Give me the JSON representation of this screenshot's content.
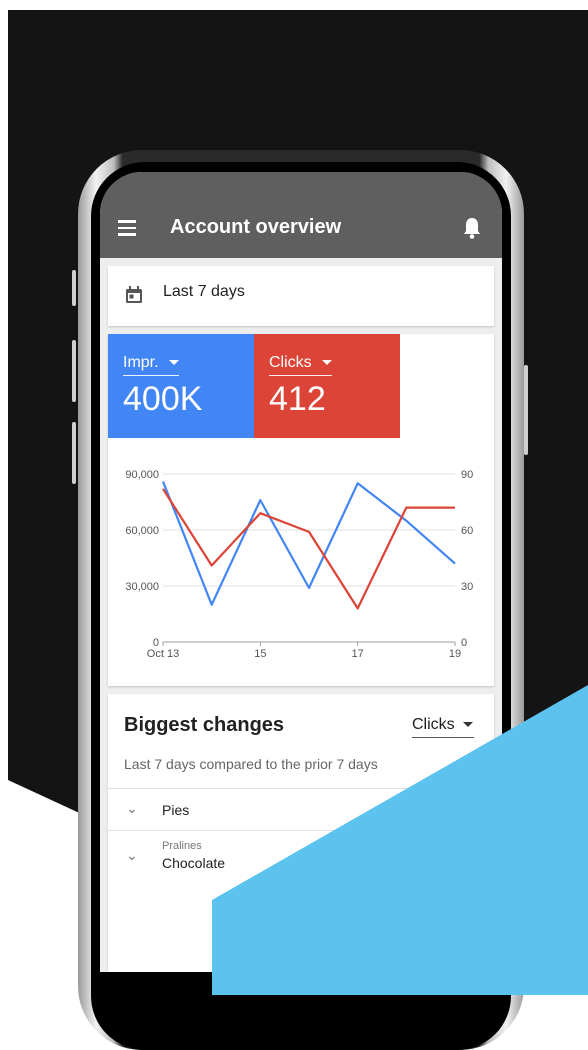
{
  "app": {
    "title": "Account overview"
  },
  "date_range": {
    "label": "Last 7 days"
  },
  "metrics": [
    {
      "label": "Impr.",
      "value": "400K",
      "color": "#4285f4"
    },
    {
      "label": "Clicks",
      "value": "412",
      "color": "#db4437"
    }
  ],
  "colors": {
    "appbar": "#5f5f5f",
    "background_dark": "#141414",
    "accent_shape": "#5bc3ee"
  },
  "chart_data": {
    "type": "line",
    "x_tick_labels": [
      "Oct 13",
      "15",
      "17",
      "19"
    ],
    "x": [
      13,
      14,
      15,
      16,
      17,
      18,
      19
    ],
    "y_left_ticks": [
      "0",
      "30,000",
      "60,000",
      "90,000"
    ],
    "y_right_ticks": [
      "0",
      "30",
      "60",
      "90"
    ],
    "y_left_range": [
      0,
      90000
    ],
    "y_right_range": [
      0,
      90
    ],
    "series": [
      {
        "color": "#4285f4",
        "axis": "left",
        "values": [
          86000,
          20000,
          76000,
          29000,
          85000,
          65000,
          42000
        ]
      },
      {
        "color": "#db4437",
        "axis": "right",
        "values": [
          82,
          41,
          69,
          59,
          18,
          72,
          72
        ]
      }
    ],
    "grid": true
  },
  "changes": {
    "title": "Biggest changes",
    "metric_select": "Clicks",
    "subtitle": "Last 7 days compared to the prior 7 days",
    "rows": [
      {
        "label": "Pies",
        "sublabel": ""
      },
      {
        "label": "Chocolate",
        "sublabel": "Pralines"
      }
    ]
  }
}
